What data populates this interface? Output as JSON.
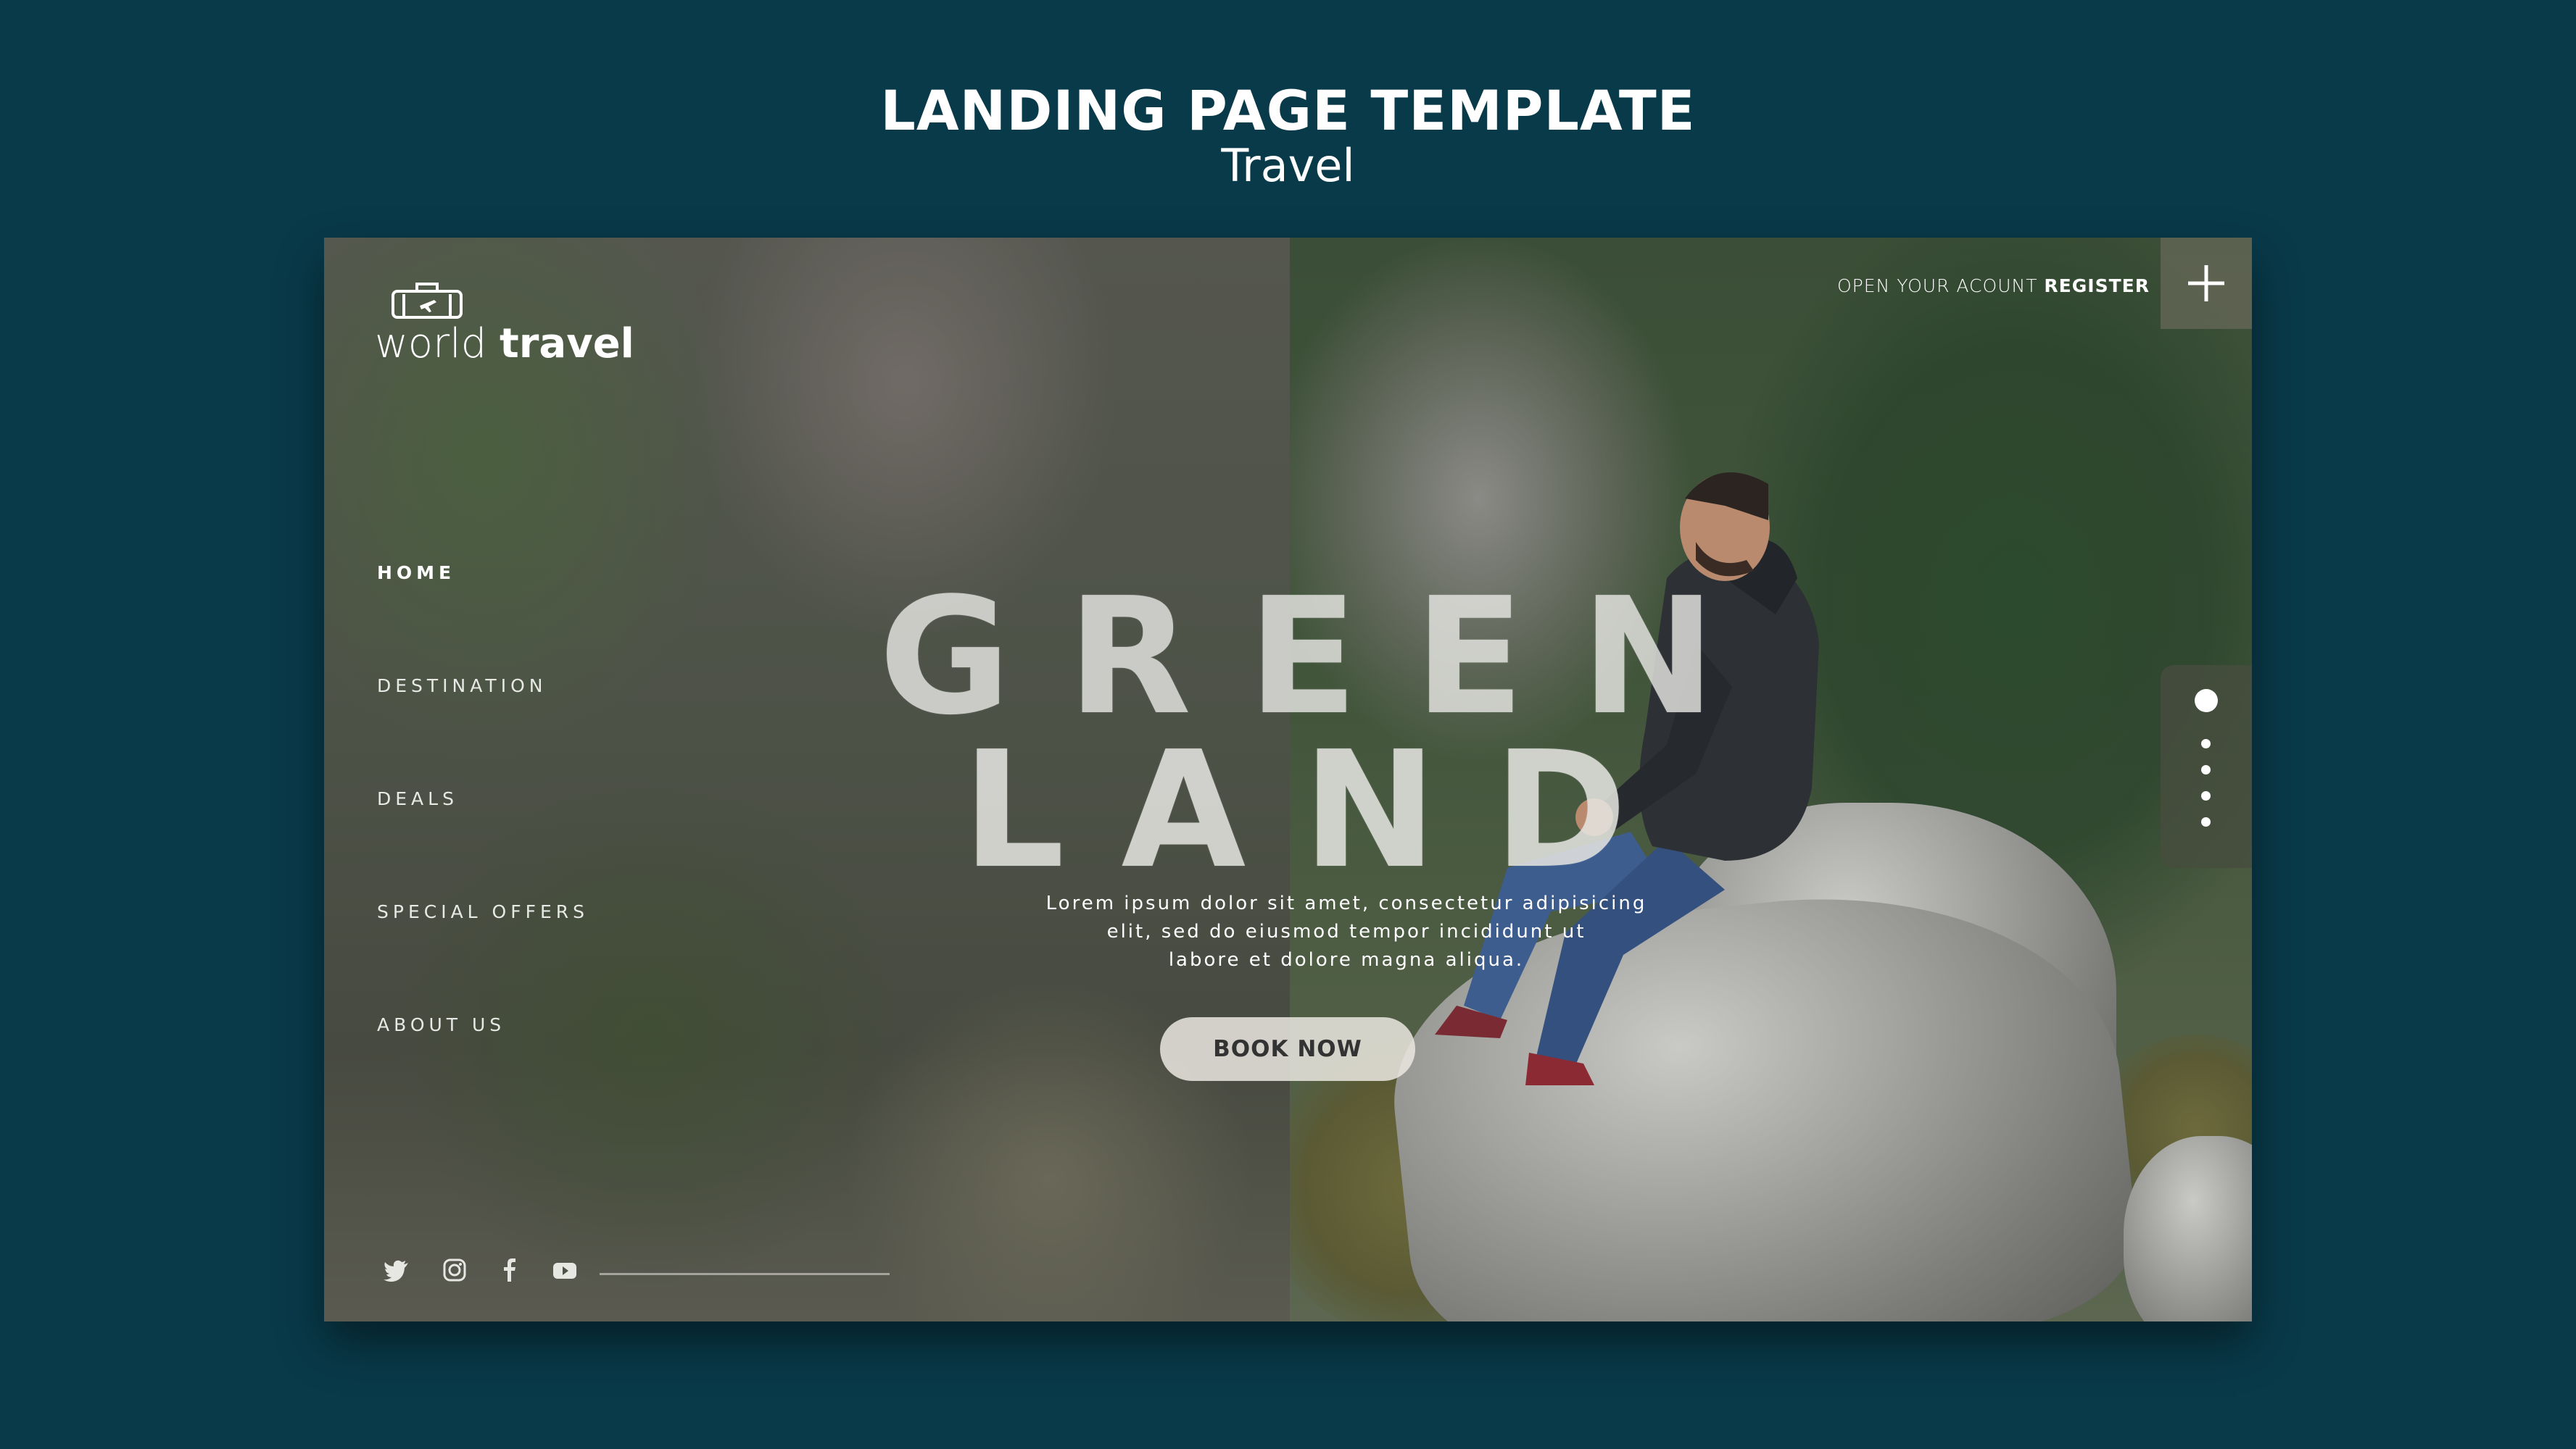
{
  "heading": {
    "title": "LANDING PAGE TEMPLATE",
    "subtitle": "Travel"
  },
  "brand": {
    "word1": "world",
    "word2": "travel"
  },
  "nav": {
    "items": [
      {
        "label": "HOME",
        "active": true
      },
      {
        "label": "DESTINATION",
        "active": false
      },
      {
        "label": "DEALS",
        "active": false
      },
      {
        "label": "SPECIAL OFFERS",
        "active": false
      },
      {
        "label": "ABOUT US",
        "active": false
      }
    ]
  },
  "hero": {
    "line1": "GREEN",
    "line2": "LAND",
    "description": [
      "Lorem ipsum dolor sit amet, consectetur adipisicing",
      "elit, sed do eiusmod tempor incididunt ut",
      "labore et dolore magna aliqua."
    ],
    "cta_label": "BOOK NOW"
  },
  "account": {
    "prompt": "OPEN YOUR ACOUNT",
    "action": "REGISTER"
  },
  "social": {
    "icons": [
      "twitter-icon",
      "instagram-icon",
      "facebook-icon",
      "youtube-icon"
    ]
  },
  "pagination": {
    "count": 5,
    "active_index": 0
  },
  "colors": {
    "background": "#093a4a",
    "text": "#ffffff",
    "button_bg": "#ebe8e0",
    "button_text": "#333333"
  }
}
